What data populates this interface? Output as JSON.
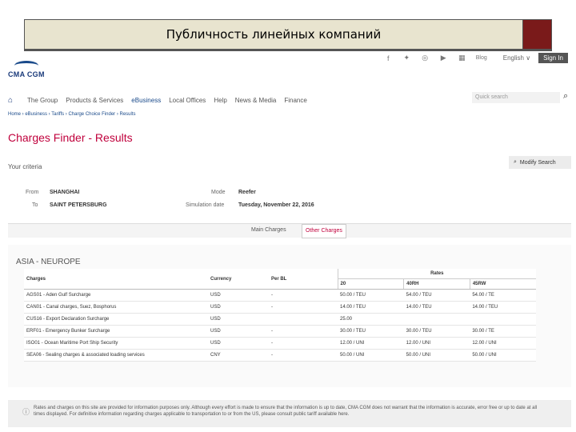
{
  "slide_title": "Публичность линейных компаний",
  "brand": {
    "name": "CMA CGM"
  },
  "social": {
    "icons": [
      "facebook-icon",
      "twitter-icon",
      "instagram-icon",
      "youtube-icon",
      "linkedin-icon"
    ],
    "blog_label": "Blog",
    "language": "English",
    "signin_label": "Sign In"
  },
  "nav": {
    "items": [
      "The Group",
      "Products & Services",
      "eBusiness",
      "Local Offices",
      "Help",
      "News & Media",
      "Finance"
    ],
    "active": "eBusiness",
    "search_placeholder": "Quick search"
  },
  "breadcrumb": "Home › eBusiness › Tariffs › Charge Choice Finder › Results",
  "page_title": "Charges Finder - Results",
  "criteria": {
    "heading": "Your criteria",
    "from_label": "From",
    "from_value": "SHANGHAI",
    "to_label": "To",
    "to_value": "SAINT PETERSBURG",
    "mode_label": "Mode",
    "mode_value": "Reefer",
    "date_label": "Simulation date",
    "date_value": "Tuesday, November 22, 2016",
    "modify_label": "Modify Search"
  },
  "tabs": {
    "main": "Main Charges",
    "other": "Other Charges"
  },
  "section_title": "ASIA - NEUROPE",
  "table": {
    "headers": [
      "Charges",
      "Currency",
      "Per BL",
      "Rates"
    ],
    "rate_headers": [
      "20",
      "40RH",
      "45RW"
    ],
    "rows": [
      [
        "AGS01 - Aden Gulf Surcharge",
        "USD",
        "-",
        "50.00 / TEU",
        "54.00 / TEU",
        "54.00 / TE"
      ],
      [
        "CAN01 - Canal charges, Suez, Bosphorus",
        "USD",
        "-",
        "14.00 / TEU",
        "14.00 / TEU",
        "14.00 / TEU"
      ],
      [
        "CUS16 - Export Declaration Surcharge",
        "USD",
        "",
        "25.00",
        "",
        ""
      ],
      [
        "ERF01 - Emergency Bunker Surcharge",
        "USD",
        "-",
        "30.00 / TEU",
        "30.00 / TEU",
        "30.00 / TE"
      ],
      [
        "ISO01 - Ocean Maritime Port Ship Security",
        "USD",
        "-",
        "12.00 / UNI",
        "12.00 / UNI",
        "12.00 / UNI"
      ],
      [
        "SEA06 - Sealing charges & associated loading services",
        "CNY",
        "-",
        "50.00 / UNI",
        "50.00 / UNI",
        "50.00 / UNI"
      ]
    ]
  },
  "note": "Rates and charges on this site are provided for information purposes only. Although every effort is made to ensure that the information is up to date, CMA CGM does not warrant that the information is accurate, error free or up to date at all times displayed. For definitive information regarding charges applicable to transportation to or from the US, please consult public tariff available here."
}
